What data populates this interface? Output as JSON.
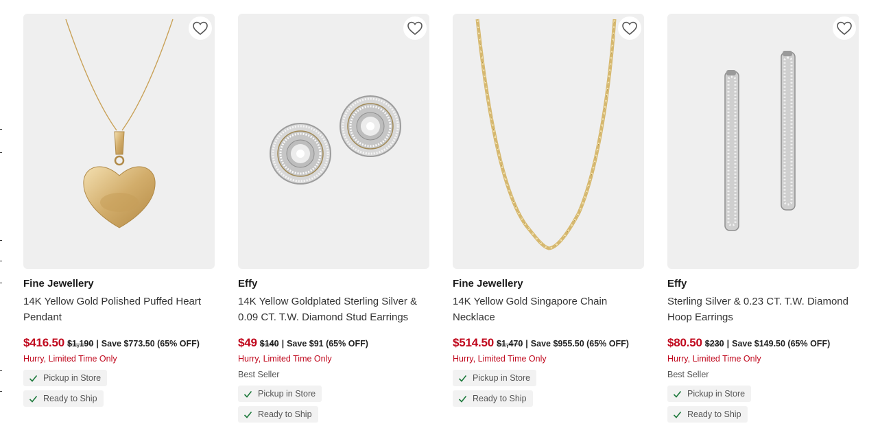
{
  "products": [
    {
      "brand": "Fine Jewellery",
      "title": "14K Yellow Gold Polished Puffed Heart Pendant",
      "price": "$416.50",
      "original_price": "$1,190",
      "separator": "|",
      "save_text": "Save $773.50 (65% OFF)",
      "urgency": "Hurry, Limited Time Only",
      "badge": "",
      "fulfillment": [
        "Pickup in Store",
        "Ready to Ship"
      ],
      "image_icon": "heart-pendant-image",
      "wishlist_icon": "heart-outline-icon"
    },
    {
      "brand": "Effy",
      "title": "14K Yellow Goldplated Sterling Silver & 0.09 CT. T.W. Diamond Stud Earrings",
      "price": "$49",
      "original_price": "$140",
      "separator": "|",
      "save_text": "Save $91 (65% OFF)",
      "urgency": "Hurry, Limited Time Only",
      "badge": "Best Seller",
      "fulfillment": [
        "Pickup in Store",
        "Ready to Ship"
      ],
      "image_icon": "stud-earrings-image",
      "wishlist_icon": "heart-outline-icon"
    },
    {
      "brand": "Fine Jewellery",
      "title": "14K Yellow Gold Singapore Chain Necklace",
      "price": "$514.50",
      "original_price": "$1,470",
      "separator": "|",
      "save_text": "Save $955.50 (65% OFF)",
      "urgency": "Hurry, Limited Time Only",
      "badge": "",
      "fulfillment": [
        "Pickup in Store",
        "Ready to Ship"
      ],
      "image_icon": "chain-necklace-image",
      "wishlist_icon": "heart-outline-icon"
    },
    {
      "brand": "Effy",
      "title": "Sterling Silver & 0.23 CT. T.W. Diamond Hoop Earrings",
      "price": "$80.50",
      "original_price": "$230",
      "separator": "|",
      "save_text": "Save $149.50 (65% OFF)",
      "urgency": "Hurry, Limited Time Only",
      "badge": "Best Seller",
      "fulfillment": [
        "Pickup in Store",
        "Ready to Ship"
      ],
      "image_icon": "hoop-earrings-image",
      "wishlist_icon": "heart-outline-icon"
    }
  ],
  "colors": {
    "price_red": "#c0081d",
    "image_bg": "#efefef",
    "chip_bg": "#f2f2f2",
    "check_green": "#1e7a3c",
    "gold": "#d4b46a",
    "silver": "#c9c9c9"
  }
}
